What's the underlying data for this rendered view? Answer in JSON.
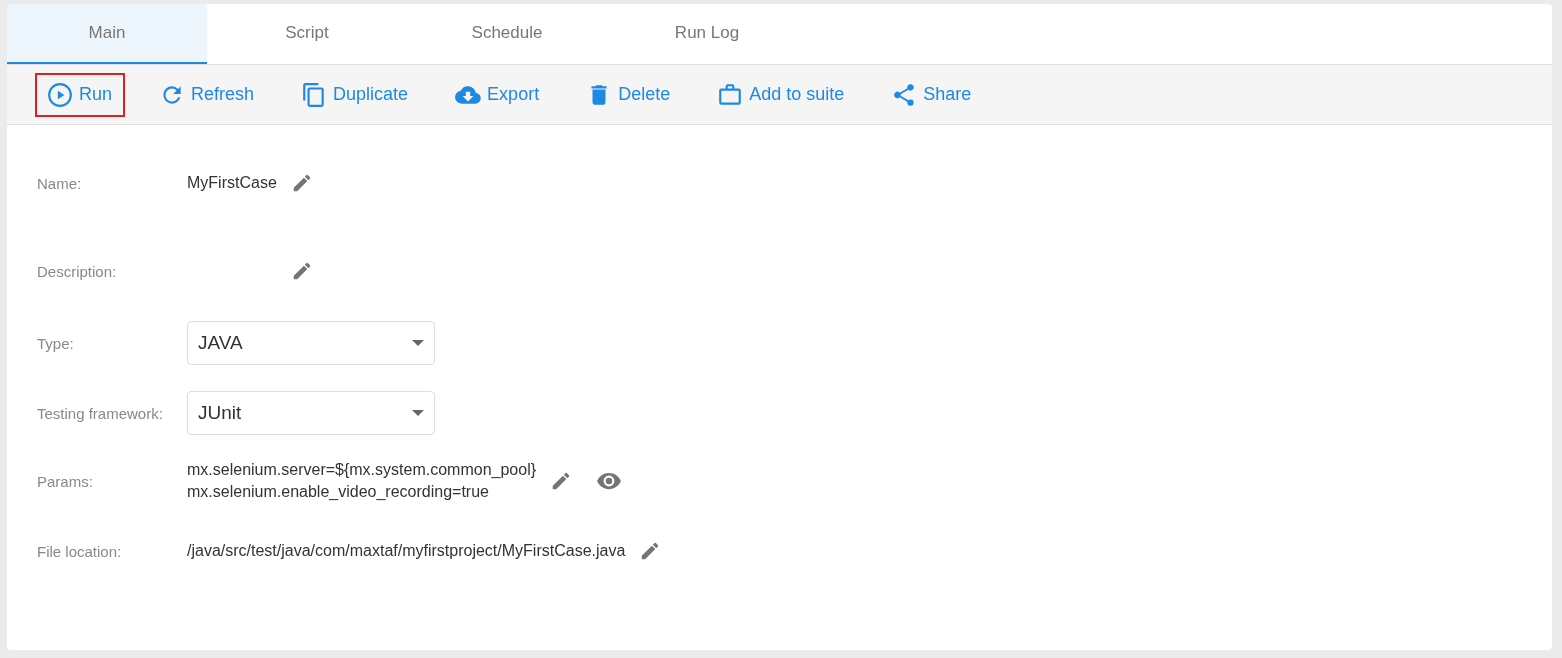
{
  "tabs": [
    {
      "label": "Main",
      "selected": true
    },
    {
      "label": "Script",
      "selected": false
    },
    {
      "label": "Schedule",
      "selected": false
    },
    {
      "label": "Run Log",
      "selected": false
    }
  ],
  "actions": [
    {
      "kind": "play",
      "label": "Run",
      "highlighted": true
    },
    {
      "kind": "refresh",
      "label": "Refresh",
      "highlighted": false
    },
    {
      "kind": "copy",
      "label": "Duplicate",
      "highlighted": false
    },
    {
      "kind": "cloud",
      "label": "Export",
      "highlighted": false
    },
    {
      "kind": "trash",
      "label": "Delete",
      "highlighted": false
    },
    {
      "kind": "briefcase",
      "label": "Add to suite",
      "highlighted": false
    },
    {
      "kind": "share",
      "label": "Share",
      "highlighted": false
    }
  ],
  "fields": [
    {
      "kind": "text",
      "label": "Name:",
      "value": "MyFirstCase"
    },
    {
      "kind": "text",
      "label": "Description:"
    },
    {
      "kind": "select",
      "label": "Type:",
      "value": "JAVA"
    },
    {
      "kind": "select",
      "label": "Testing framework:",
      "value": "JUnit"
    },
    {
      "kind": "params",
      "label": "Params:",
      "lines": [
        "mx.selenium.server=${mx.system.common_pool}",
        "mx.selenium.enable_video_recording=true"
      ]
    },
    {
      "kind": "text",
      "label": "File location:",
      "value": "/java/src/test/java/com/maxtaf/myfirstproject/MyFirstCase.java"
    }
  ]
}
